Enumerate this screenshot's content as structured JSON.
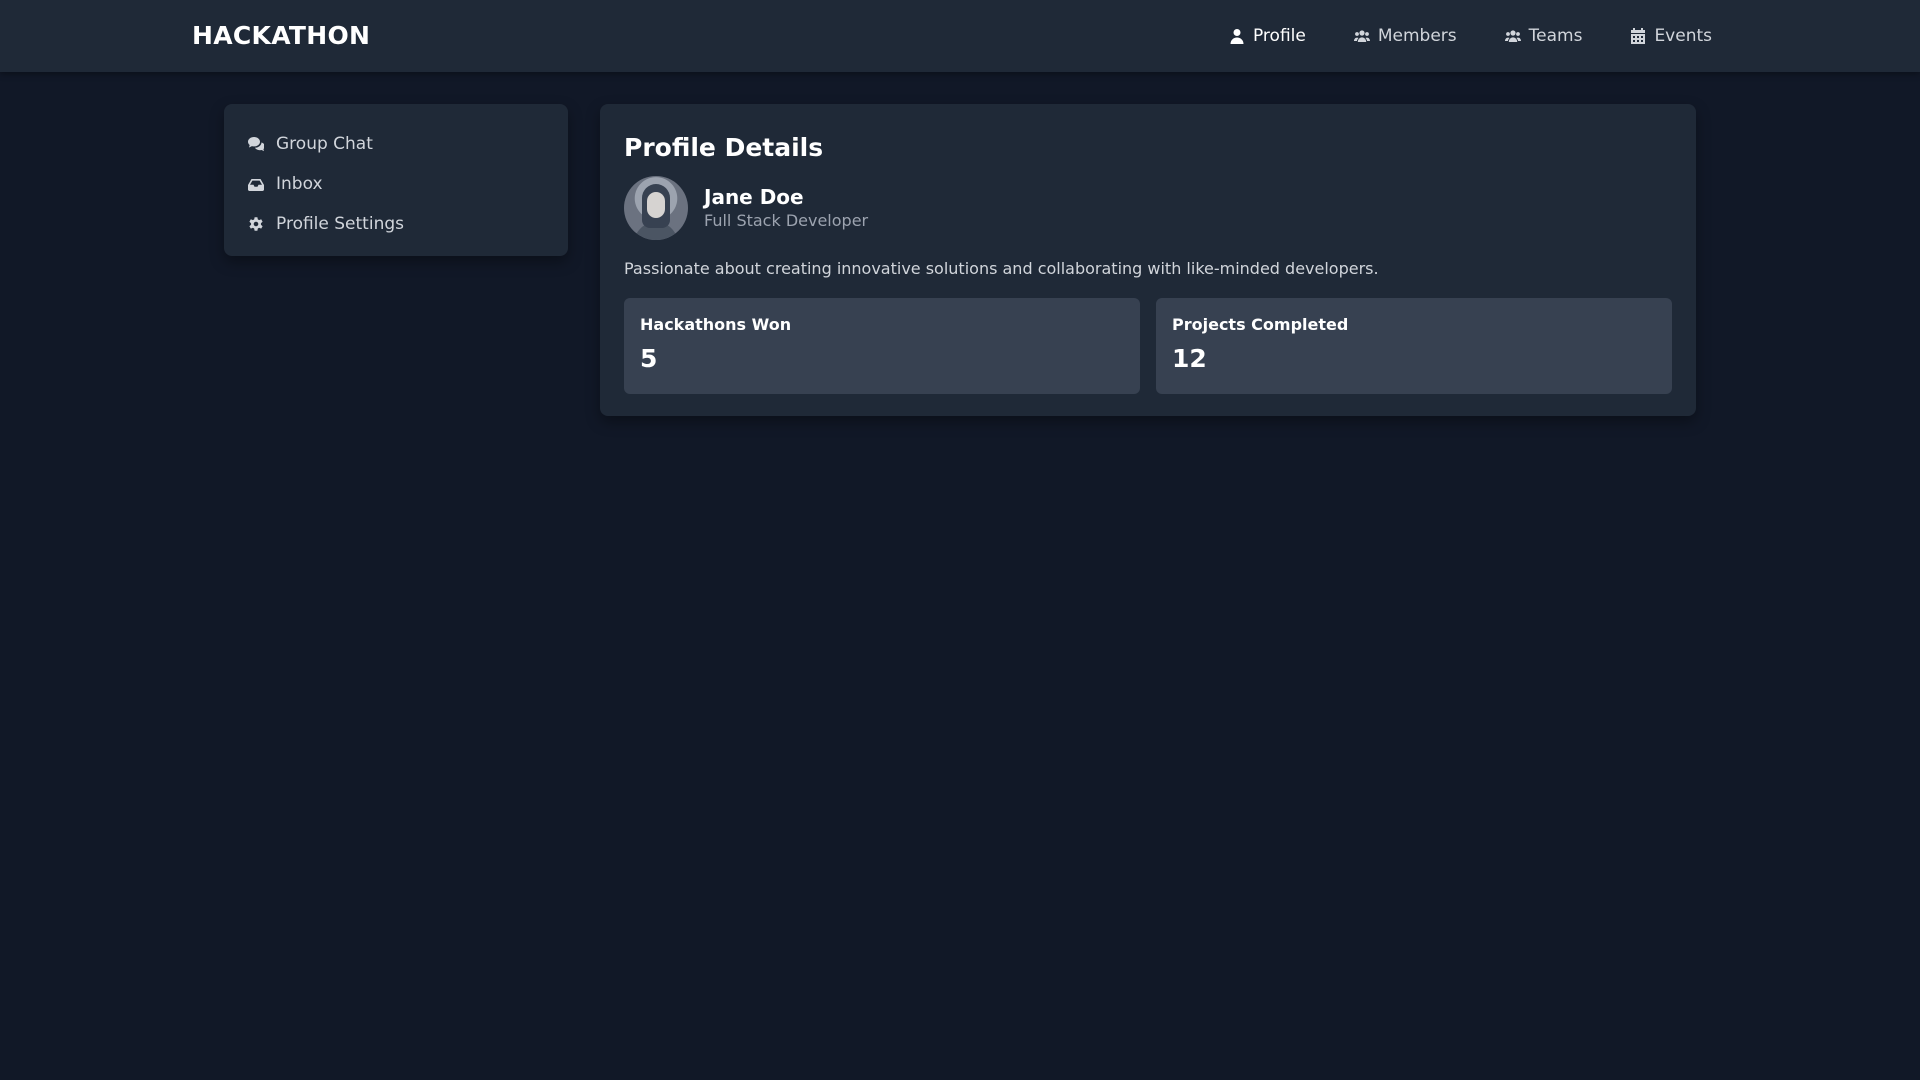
{
  "header": {
    "brand": "HACKATHON",
    "nav": [
      {
        "label": "Profile",
        "icon": "user-icon",
        "active": true
      },
      {
        "label": "Members",
        "icon": "users-icon",
        "active": false
      },
      {
        "label": "Teams",
        "icon": "users-icon",
        "active": false
      },
      {
        "label": "Events",
        "icon": "calendar-icon",
        "active": false
      }
    ]
  },
  "sidebar": {
    "items": [
      {
        "label": "Group Chat",
        "icon": "chat-bubbles-icon"
      },
      {
        "label": "Inbox",
        "icon": "inbox-icon"
      },
      {
        "label": "Profile Settings",
        "icon": "gear-icon"
      }
    ]
  },
  "profile": {
    "title": "Profile Details",
    "name": "Jane Doe",
    "role": "Full Stack Developer",
    "bio": "Passionate about creating innovative solutions and collaborating with like-minded developers.",
    "stats": [
      {
        "label": "Hackathons Won",
        "value": "5"
      },
      {
        "label": "Projects Completed",
        "value": "12"
      }
    ]
  },
  "colors": {
    "background": "#111827",
    "panel": "#1f2937",
    "stat_card": "#374151",
    "muted_text": "#9ca3af"
  }
}
